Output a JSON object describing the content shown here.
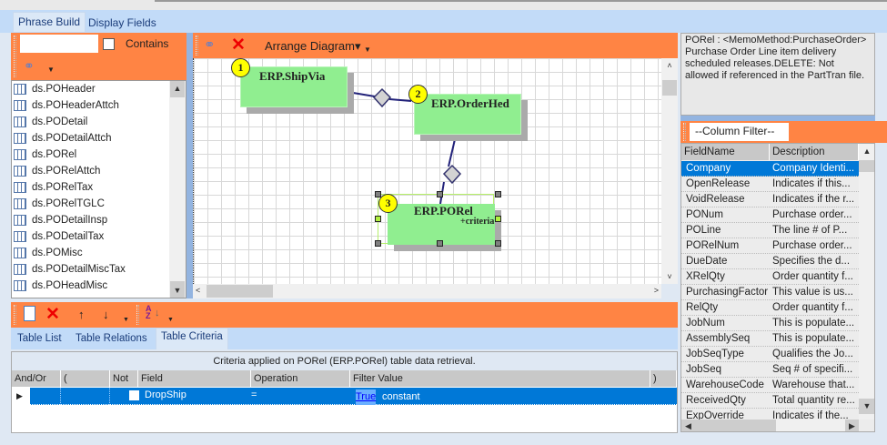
{
  "tabs": {
    "top": [
      {
        "label": "Phrase Build"
      },
      {
        "label": "Display Fields"
      }
    ],
    "bottom": [
      {
        "label": "Table List"
      },
      {
        "label": "Table Relations"
      },
      {
        "label": "Table Criteria"
      }
    ]
  },
  "left": {
    "search_value": "",
    "contains_label": "Contains",
    "tables": [
      "ds.POHeader",
      "ds.POHeaderAttch",
      "ds.PODetail",
      "ds.PODetailAttch",
      "ds.PORel",
      "ds.PORelAttch",
      "ds.PORelTax",
      "ds.PORelTGLC",
      "ds.PODetailInsp",
      "ds.PODetailTax",
      "ds.POMisc",
      "ds.PODetailMiscTax",
      "ds.POHeadMisc"
    ]
  },
  "diagram": {
    "arrange_label": "Arrange Diagram",
    "nodes": [
      {
        "num": "1",
        "name": "ERP.ShipVia"
      },
      {
        "num": "2",
        "name": "ERP.OrderHed"
      },
      {
        "num": "3",
        "name": "ERP.PORel",
        "note": "+criteria"
      }
    ]
  },
  "memo": "PORel : <MemoMethod:PurchaseOrder> Purchase Order Line item delivery scheduled releases.DELETE: Not allowed if referenced in the PartTran file.",
  "column_filter": "--Column Filter--",
  "fields": {
    "headers": [
      "FieldName",
      "Description"
    ],
    "rows": [
      [
        "Company",
        "Company Identi..."
      ],
      [
        "OpenRelease",
        "Indicates if this..."
      ],
      [
        "VoidRelease",
        "Indicates if the r..."
      ],
      [
        "PONum",
        "Purchase order..."
      ],
      [
        "POLine",
        "The line # of  P..."
      ],
      [
        "PORelNum",
        "Purchase order..."
      ],
      [
        "DueDate",
        "Specifies the d..."
      ],
      [
        "XRelQty",
        "Order quantity f..."
      ],
      [
        "PurchasingFactor",
        "This value is us..."
      ],
      [
        "RelQty",
        "Order quantity f..."
      ],
      [
        "JobNum",
        "This is populate..."
      ],
      [
        "AssemblySeq",
        "This is populate..."
      ],
      [
        "JobSeqType",
        "Qualifies the Jo..."
      ],
      [
        "JobSeq",
        "Seq # of specifi..."
      ],
      [
        "WarehouseCode",
        "Warehouse that..."
      ],
      [
        "ReceivedQty",
        "Total quantity re..."
      ],
      [
        "ExpOverride",
        "Indicates if the..."
      ]
    ]
  },
  "criteria": {
    "caption": "Criteria applied on PORel (ERP.PORel)  table data retrieval.",
    "headers": [
      "And/Or",
      "(",
      "Not",
      "Field",
      "Operation",
      "Filter Value",
      ")"
    ],
    "rows": [
      {
        "andor": "",
        "paren_open": "",
        "not": false,
        "field": "DropShip",
        "operation": "=",
        "value_link": "True",
        "value_type": "constant",
        "paren_close": ""
      }
    ]
  },
  "colors": {
    "accent": "#ff8444",
    "selection": "#0078d7",
    "node": "#90ee90"
  }
}
